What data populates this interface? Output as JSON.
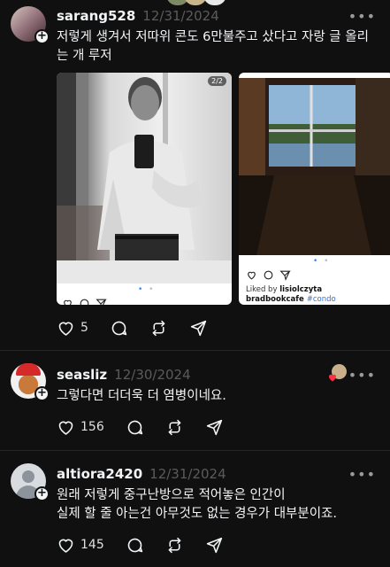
{
  "posts": [
    {
      "username": "sarang528",
      "date": "12/31/2024",
      "text": "저렇게 생겨서 저따위 콘도 6만불주고 샀다고 자랑 글 올리는 개 루저",
      "likes": "5",
      "embedded": {
        "image_counter": "2/2",
        "liked_by_label": "Liked by",
        "liked_by_user": "lisiolczyta",
        "caption_user": "bradbookcafe",
        "caption_tag": "#condo"
      }
    },
    {
      "username": "seasliz",
      "date": "12/30/2024",
      "text": "그렇다면 더더욱 더 염병이네요.",
      "likes": "156"
    },
    {
      "username": "altiora2420",
      "date": "12/31/2024",
      "text_line1": "원래 저렇게 중구난방으로 적어놓은 인간이",
      "text_line2": "실제 할 줄 아는건 아무것도 없는 경우가 대부분이죠.",
      "likes": "145"
    }
  ],
  "more_glyph": "•••",
  "colors": {
    "background": "#101010",
    "text": "#f3f5f7",
    "muted": "#5b5b5b",
    "divider": "#262626",
    "heart_red": "#ff3040",
    "link_blue": "#2f6fd6"
  }
}
